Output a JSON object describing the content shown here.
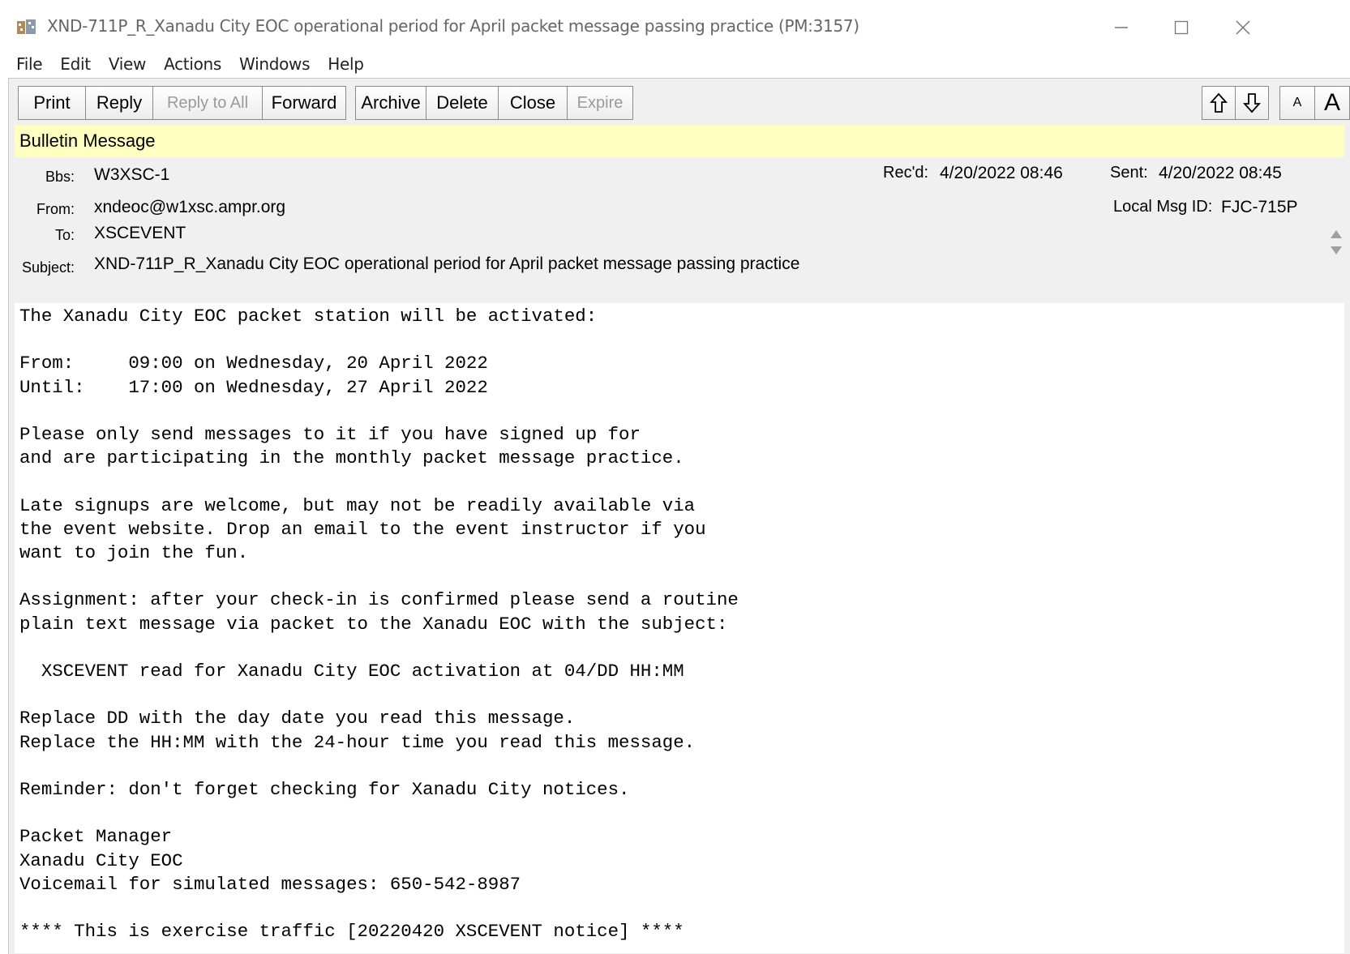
{
  "window": {
    "title": "XND-711P_R_Xanadu City EOC operational period for April packet message passing practice  (PM:3157)",
    "app_icon": "outpost-app-icon",
    "controls": [
      "minimize-icon",
      "maximize-icon",
      "close-icon"
    ]
  },
  "menu": [
    "File",
    "Edit",
    "View",
    "Actions",
    "Windows",
    "Help"
  ],
  "toolbar": {
    "print": "Print",
    "reply": "Reply",
    "reply_all": "Reply to All",
    "forward": "Forward",
    "archive": "Archive",
    "delete": "Delete",
    "close": "Close",
    "expire": "Expire",
    "font_small": "A",
    "font_large": "A",
    "prev_icon": "arrow-up-icon",
    "next_icon": "arrow-down-icon"
  },
  "banner": "Bulletin Message",
  "header": {
    "bbs_label": "Bbs:",
    "bbs": "W3XSC-1",
    "from_label": "From:",
    "from": "xndeoc@w1xsc.ampr.org",
    "to_label": "To:",
    "to": "XSCEVENT",
    "subject_label": "Subject:",
    "subject": "XND-711P_R_Xanadu City EOC operational period for April packet message passing practice",
    "recd_label": "Rec'd:",
    "recd": "4/20/2022 08:46",
    "sent_label": "Sent:",
    "sent": "4/20/2022 08:45",
    "local_id_label": "Local Msg ID:",
    "local_id": "FJC-715P"
  },
  "body": "The Xanadu City EOC packet station will be activated:\n\nFrom:     09:00 on Wednesday, 20 April 2022\nUntil:    17:00 on Wednesday, 27 April 2022\n\nPlease only send messages to it if you have signed up for\nand are participating in the monthly packet message practice.\n\nLate signups are welcome, but may not be readily available via\nthe event website. Drop an email to the event instructor if you\nwant to join the fun.\n\nAssignment: after your check-in is confirmed please send a routine\nplain text message via packet to the Xanadu EOC with the subject:\n\n  XSCEVENT read for Xanadu City EOC activation at 04/DD HH:MM\n\nReplace DD with the day date you read this message.\nReplace the HH:MM with the 24-hour time you read this message.\n\nReminder: don't forget checking for Xanadu City notices.\n\nPacket Manager\nXanadu City EOC\nVoicemail for simulated messages: 650-542-8987\n\n**** This is exercise traffic [20220420 XSCEVENT notice] ****",
  "colors": {
    "banner_bg": "#ffffc0",
    "header_bg": "#f0f0f0",
    "disabled_text": "#9a9a9a"
  }
}
